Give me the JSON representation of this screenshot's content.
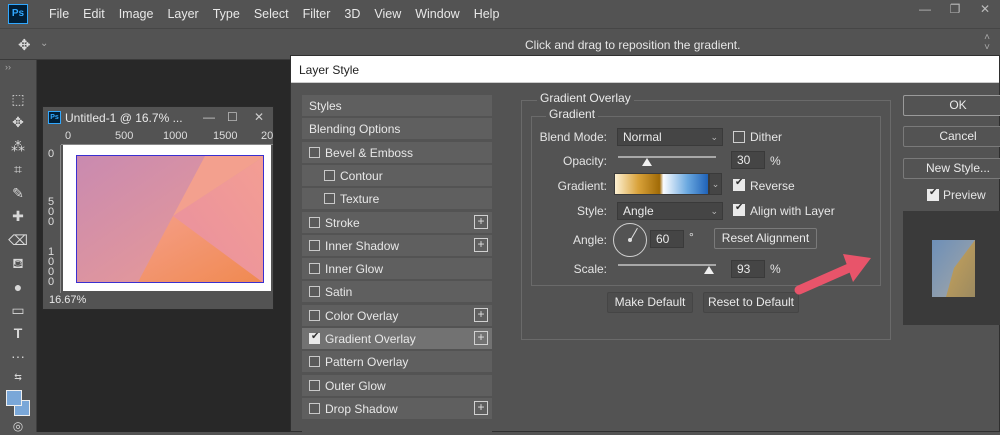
{
  "menubar": {
    "app_icon": "Ps",
    "items": [
      "File",
      "Edit",
      "Image",
      "Layer",
      "Type",
      "Select",
      "Filter",
      "3D",
      "View",
      "Window",
      "Help"
    ],
    "window_controls": [
      "minimize-icon",
      "restore-icon",
      "close-icon"
    ]
  },
  "options_bar": {
    "tool_icon": "move-tool-icon",
    "hint": "Click and drag to reposition the gradient."
  },
  "toolbar": {
    "tools": [
      "marquee-icon",
      "move-icon",
      "magic-wand-icon",
      "crop-icon",
      "brush-icon",
      "healing-icon",
      "eraser-icon",
      "paint-bucket-icon",
      "blur-icon",
      "rectangle-icon",
      "type-icon",
      "more-icon"
    ],
    "foreground_color": "#7aa7d8",
    "background_color": "#7aa7d8"
  },
  "document": {
    "icon": "Ps",
    "title": "Untitled-1 @ 16.7% ...",
    "ruler_h": [
      "0",
      "500",
      "1000",
      "1500",
      "20"
    ],
    "ruler_v": [
      "0",
      "5\n0\n0",
      "1\n0\n0\n0"
    ],
    "zoom": "16.67%"
  },
  "dialog": {
    "title": "Layer Style",
    "styles_list": [
      {
        "label": "Styles",
        "kind": "header"
      },
      {
        "label": "Blending Options",
        "kind": "header"
      },
      {
        "label": "Bevel & Emboss",
        "checked": false,
        "plus": false,
        "indent": 0
      },
      {
        "label": "Contour",
        "checked": false,
        "plus": false,
        "indent": 1
      },
      {
        "label": "Texture",
        "checked": false,
        "plus": false,
        "indent": 1
      },
      {
        "label": "Stroke",
        "checked": false,
        "plus": true,
        "indent": 0
      },
      {
        "label": "Inner Shadow",
        "checked": false,
        "plus": true,
        "indent": 0
      },
      {
        "label": "Inner Glow",
        "checked": false,
        "plus": false,
        "indent": 0
      },
      {
        "label": "Satin",
        "checked": false,
        "plus": false,
        "indent": 0
      },
      {
        "label": "Color Overlay",
        "checked": false,
        "plus": true,
        "indent": 0
      },
      {
        "label": "Gradient Overlay",
        "checked": true,
        "plus": true,
        "indent": 0,
        "selected": true
      },
      {
        "label": "Pattern Overlay",
        "checked": false,
        "plus": false,
        "indent": 0
      },
      {
        "label": "Outer Glow",
        "checked": false,
        "plus": false,
        "indent": 0
      },
      {
        "label": "Drop Shadow",
        "checked": false,
        "plus": true,
        "indent": 0
      }
    ],
    "panel": {
      "section_title": "Gradient Overlay",
      "group_title": "Gradient",
      "blend_mode_label": "Blend Mode:",
      "blend_mode_value": "Normal",
      "dither_label": "Dither",
      "dither_checked": false,
      "opacity_label": "Opacity:",
      "opacity_value": "30",
      "opacity_unit": "%",
      "opacity_level": 0.3,
      "gradient_label": "Gradient:",
      "reverse_label": "Reverse",
      "reverse_checked": true,
      "style_label": "Style:",
      "style_value": "Angle",
      "align_label": "Align with Layer",
      "align_checked": true,
      "angle_label": "Angle:",
      "angle_value": "60",
      "angle_unit": "°",
      "reset_alignment": "Reset Alignment",
      "scale_label": "Scale:",
      "scale_value": "93",
      "scale_unit": "%",
      "scale_level": 0.93,
      "make_default": "Make Default",
      "reset_default": "Reset to Default"
    },
    "buttons": {
      "ok": "OK",
      "cancel": "Cancel",
      "new_style": "New Style...",
      "preview_label": "Preview",
      "preview_checked": true
    },
    "annotation_color": "#e8546a"
  }
}
